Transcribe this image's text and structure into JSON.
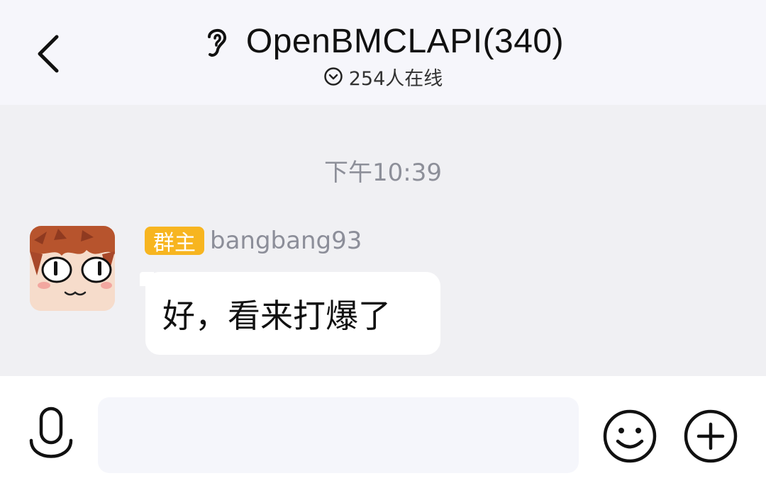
{
  "header": {
    "back_icon": "chevron-left-icon",
    "mode_icon": "ear-icon",
    "title": "OpenBMCLAPI(340)",
    "online_icon": "chevron-down-circle-icon",
    "online_count": "254人在线"
  },
  "chat": {
    "timestamp": "下午10:39",
    "messages": [
      {
        "avatar_icon": "anime-avatar",
        "role_badge": "群主",
        "sender": "bangbang93",
        "text": "好，看来打爆了"
      }
    ]
  },
  "input_bar": {
    "voice_icon": "microphone-icon",
    "input_value": "",
    "emoji_icon": "smiley-icon",
    "more_icon": "plus-circle-icon"
  },
  "colors": {
    "badge": "#f7b520",
    "header_bg": "#f6f6fb",
    "chat_bg": "#f0f0f3"
  }
}
